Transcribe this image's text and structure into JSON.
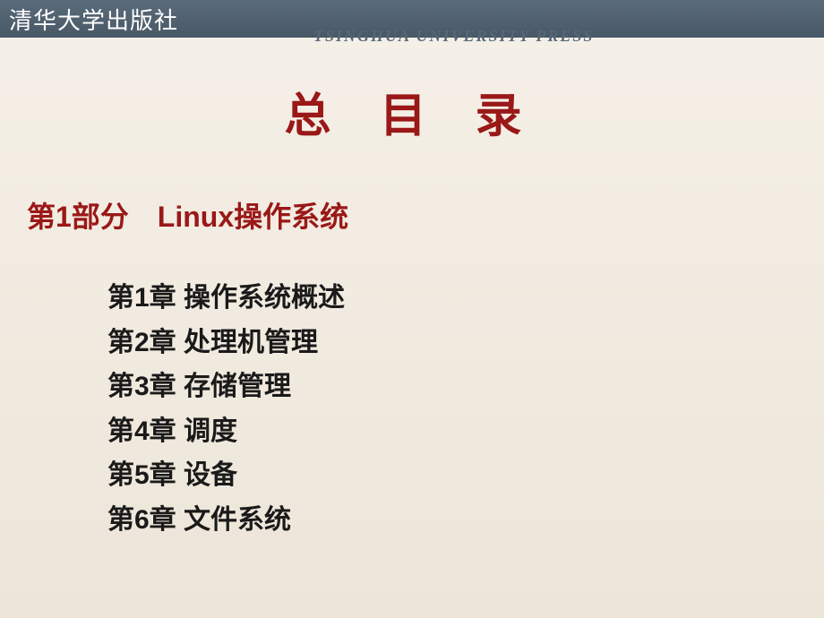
{
  "header": {
    "publisher_cn": "清华大学出版社",
    "publisher_en": "TSINGHUA UNIVERSITY PRESS"
  },
  "title": "总 目 录",
  "section": "第1部分　Linux操作系统",
  "chapters": [
    "第1章  操作系统概述",
    "第2章  处理机管理",
    "第3章  存储管理",
    "第4章  调度",
    "第5章  设备",
    "第6章  文件系统"
  ]
}
